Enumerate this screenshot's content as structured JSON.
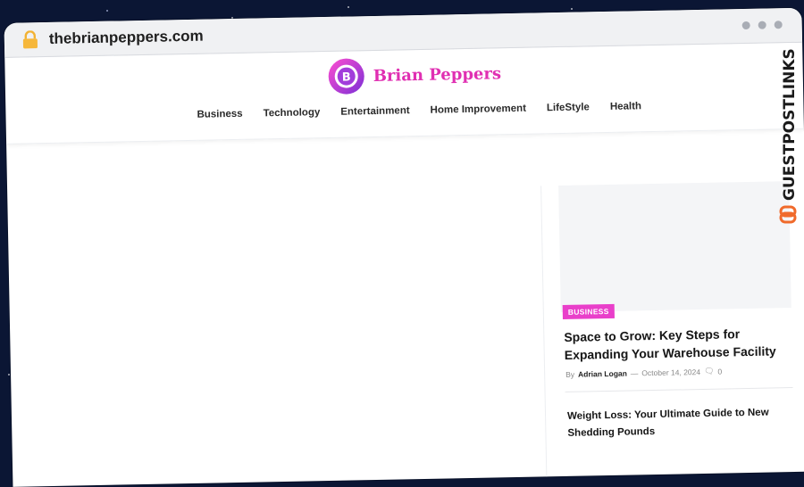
{
  "browser": {
    "url": "thebrianpeppers.com"
  },
  "site": {
    "logo_letter": "B",
    "name": "Brian Peppers"
  },
  "nav": [
    {
      "label": "Business"
    },
    {
      "label": "Technology"
    },
    {
      "label": "Entertainment"
    },
    {
      "label": "Home Improvement"
    },
    {
      "label": "LifeStyle"
    },
    {
      "label": "Health"
    }
  ],
  "sidebar": {
    "featured": {
      "category": "BUSINESS",
      "title": "Space to Grow: Key Steps for Expanding Your Warehouse Facility",
      "by": "By",
      "author": "Adrian Logan",
      "date": "October 14, 2024",
      "comments": "0"
    },
    "second_post_title": "Weight Loss: Your Ultimate Guide to New Shedding Pounds"
  },
  "watermark": {
    "text": "GUESTPOSTLINKS"
  },
  "colors": {
    "accent": "#e93fca",
    "logo_purple": "#7b2fd6",
    "watermark_orange": "#f06a2b",
    "background": "#0b1634"
  }
}
